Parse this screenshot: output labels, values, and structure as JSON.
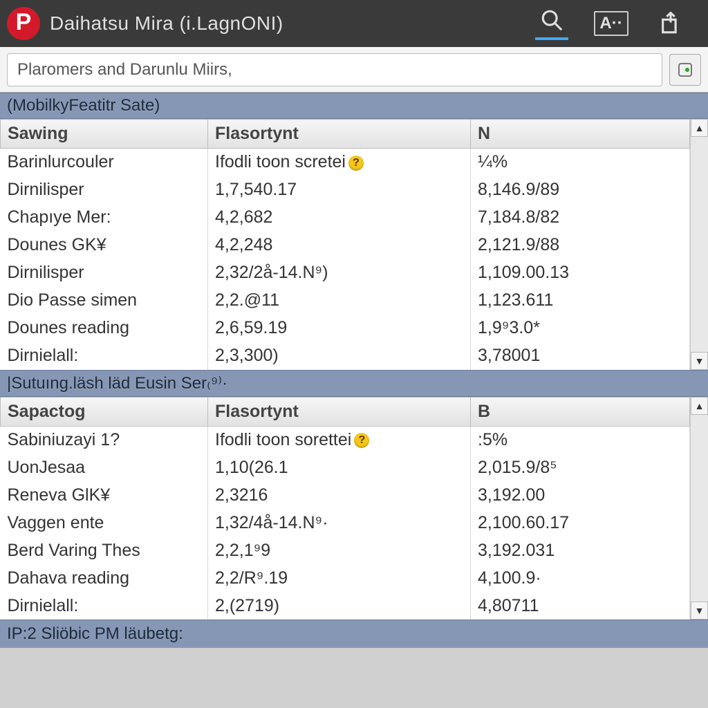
{
  "header": {
    "logo_letter": "P",
    "title": "Daihatsu Mira (i.LagnONI)",
    "icons": {
      "search": "search-icon",
      "fontsize": "A··",
      "share": "share-icon"
    }
  },
  "search": {
    "value": "Plaromers and Darunlu Miirs,"
  },
  "sections": [
    {
      "label": "(MobilkyFeatitr Sate)",
      "columns": [
        "Sawing",
        "Flasortynt",
        "N"
      ],
      "rows": [
        {
          "a": "Barinlurcouler",
          "b": "Ifodli toon scretei",
          "b_badge": true,
          "c": "¼%"
        },
        {
          "a": "Dirnilisper",
          "b": "1,7,540.17",
          "c": "8,146.9/89"
        },
        {
          "a": "Chapıye Mer:",
          "b": "4,2,682",
          "c": "7,184.8/82"
        },
        {
          "a": "Dounes GK¥",
          "b": "4,2,248",
          "c": "2,121.9/88"
        },
        {
          "a": "Dirnilisper",
          "b": "2,32/2å-14.N⁹)",
          "c": "1,109.00.13"
        },
        {
          "a": "Dio Passe simen",
          "b": "2,2.@11",
          "c": "1,123.611"
        },
        {
          "a": "Dounes reading",
          "b": "2,6,59.19",
          "c": "1,9⁹3.0*"
        },
        {
          "a": "Dirnielall:",
          "b": "2,3,300)",
          "c": "3,78001"
        }
      ]
    },
    {
      "label": "|Sutuıng.läsh läd Eusin Ser₍⁹⁾·",
      "columns": [
        "Sapactog",
        "Flasortynt",
        "B"
      ],
      "rows": [
        {
          "a": "Sabiniuzayi 1?",
          "b": "Ifodli toon sorettei",
          "b_badge": true,
          "c": ":5%"
        },
        {
          "a": "UonJesaa",
          "b": "1,10(26.1",
          "c": "2,015.9/8⁵"
        },
        {
          "a": "Reneva GlK¥",
          "b": "2,3216",
          "c": "3,192.00"
        },
        {
          "a": "Vaggen ente",
          "b": "1,32/4å-14.N⁹·",
          "c": "2,100.60.17"
        },
        {
          "a": "Berd Varing Thes",
          "b": "2,2,1⁹9",
          "c": "3,192.031"
        },
        {
          "a": "Dahava reading",
          "b": "2,2/R⁹.19",
          "c": "4,100.9·"
        },
        {
          "a": "Dirnielall:",
          "b": "2,(2719)",
          "c": "4,80711"
        }
      ]
    }
  ],
  "footer": "IP:2 Sliöbic PM läubetg:"
}
